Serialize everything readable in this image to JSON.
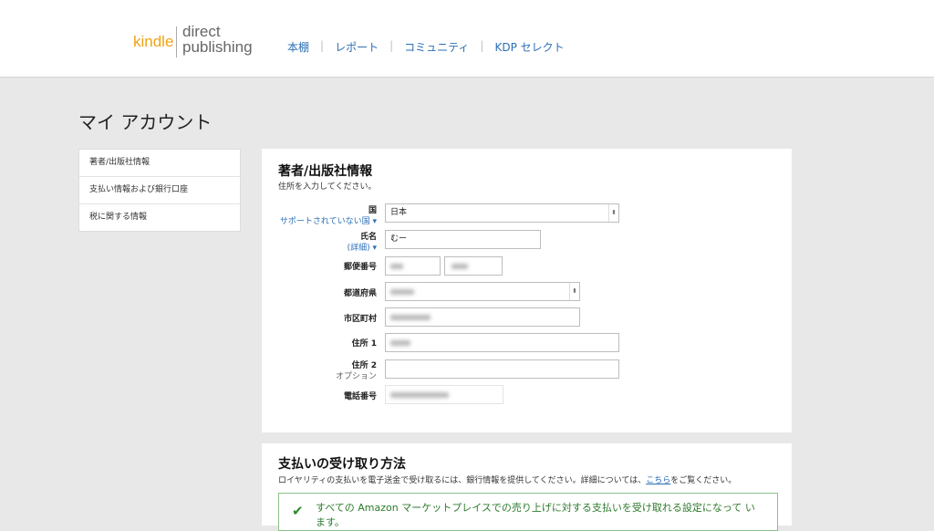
{
  "logo": {
    "kindle": "kindle",
    "direct": "direct",
    "publishing": "publishing"
  },
  "nav": {
    "bookshelf": "本棚",
    "reports": "レポート",
    "community": "コミュニティ",
    "kdp_select": "KDP セレクト",
    "separator": "|"
  },
  "page_title": "マイ アカウント",
  "sidebar": {
    "items": [
      {
        "label": "著者/出版社情報"
      },
      {
        "label": "支払い情報および銀行口座"
      },
      {
        "label": "税に関する情報"
      }
    ]
  },
  "author_section": {
    "title": "著者/出版社情報",
    "subtitle": "住所を入力してください。",
    "country_label": "国",
    "country_unsupported": "サポートされていない国 ▾",
    "country_value": "日本",
    "name_label": "氏名",
    "name_details": "(詳細) ▾",
    "name_value": "むー",
    "postal_label": "郵便番号",
    "prefecture_label": "都道府県",
    "city_label": "市区町村",
    "address1_label": "住所 1",
    "address2_label": "住所 2",
    "address2_optional": "オプション",
    "phone_label": "電話番号"
  },
  "payment_section": {
    "title": "支払いの受け取り方法",
    "subtitle_pre": "ロイヤリティの支払いを電子送金で受け取るには、銀行情報を提供してください。詳細については、",
    "subtitle_link": "こちら",
    "subtitle_post": "をご覧ください。",
    "notice": "すべての Amazon マーケットプレイスでの売り上げに対する支払いを受け取れる設定になって います。"
  },
  "colors": {
    "accent_link": "#2b6fb6",
    "logo_orange": "#f0a313",
    "success_green": "#2b8a2b"
  },
  "icons": {
    "check": "check-icon",
    "select": "select-arrow-icon"
  }
}
